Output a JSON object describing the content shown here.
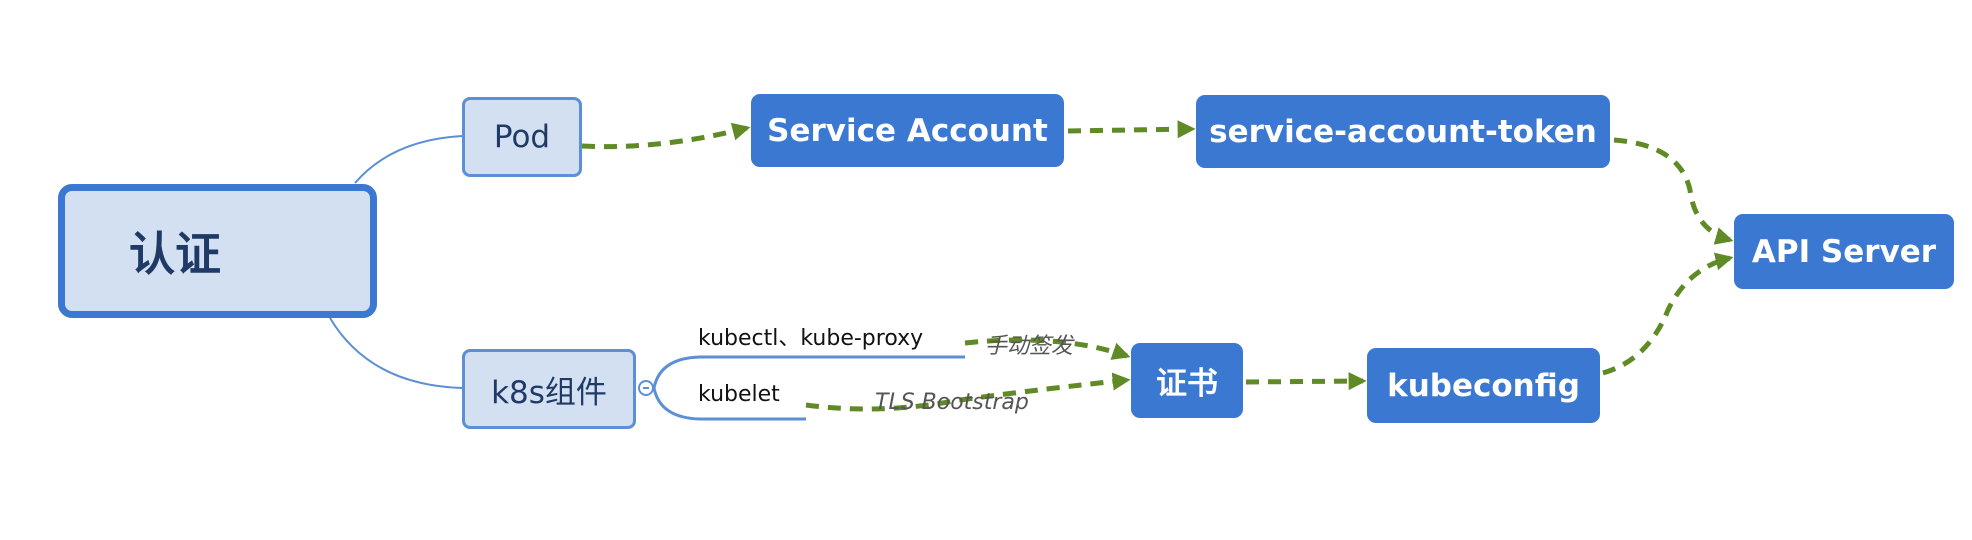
{
  "root": {
    "label": "认证"
  },
  "branches": {
    "pod": {
      "label": "Pod"
    },
    "k8s": {
      "label": "k8s组件"
    }
  },
  "k8s_children": {
    "kubectl": {
      "label": "kubectl、kube-proxy"
    },
    "kubelet": {
      "label": "kubelet"
    }
  },
  "nodes": {
    "service_account": {
      "label": "Service Account"
    },
    "sa_token": {
      "label": "service-account-token"
    },
    "api_server": {
      "label": "API Server"
    },
    "cert": {
      "label": "证书"
    },
    "kubeconfig": {
      "label": "kubeconfig"
    }
  },
  "edge_labels": {
    "manual": "手动签发",
    "tls": "TLS Bootstrap"
  },
  "colors": {
    "node_fill": "#3a78d2",
    "light_fill": "#d3e0f1",
    "light_border": "#5b8fd6",
    "dashed_arrow": "#5f8a26",
    "connector": "#5b8fd6"
  }
}
